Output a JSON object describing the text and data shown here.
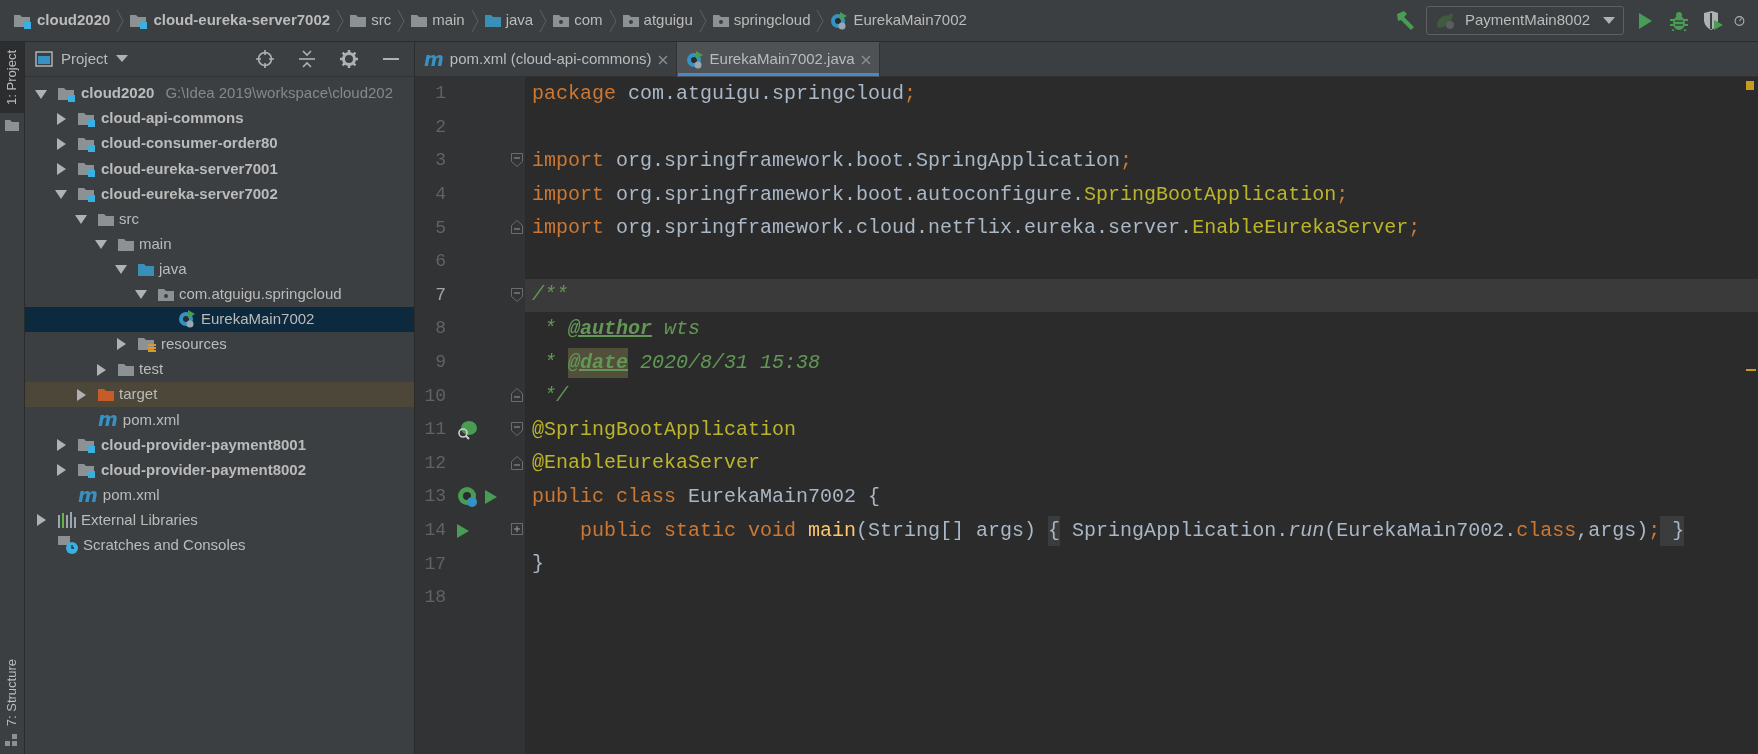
{
  "breadcrumbs": [
    {
      "label": "cloud2020",
      "kind": "module"
    },
    {
      "label": "cloud-eureka-server7002",
      "kind": "module"
    },
    {
      "label": "src",
      "kind": "folder"
    },
    {
      "label": "main",
      "kind": "folder"
    },
    {
      "label": "java",
      "kind": "source-folder"
    },
    {
      "label": "com",
      "kind": "package"
    },
    {
      "label": "atguigu",
      "kind": "package"
    },
    {
      "label": "springcloud",
      "kind": "package"
    },
    {
      "label": "EurekaMain7002",
      "kind": "class"
    }
  ],
  "run_configuration": {
    "label": "PaymentMain8002"
  },
  "tool_stripe": {
    "top": [
      {
        "label": "1: Project",
        "selected": true
      }
    ],
    "bottom": [
      {
        "label": "7: Structure",
        "selected": false
      }
    ]
  },
  "project_panel": {
    "title": "Project",
    "tree": [
      {
        "label": "cloud2020",
        "kind": "module",
        "path": "G:\\Idea 2019\\workspace\\cloud202",
        "expanded": true,
        "selected": false,
        "children": [
          {
            "label": "cloud-api-commons",
            "kind": "module",
            "expanded": false,
            "selected": false
          },
          {
            "label": "cloud-consumer-order80",
            "kind": "module",
            "expanded": false,
            "selected": false
          },
          {
            "label": "cloud-eureka-server7001",
            "kind": "module",
            "expanded": false,
            "selected": false
          },
          {
            "label": "cloud-eureka-server7002",
            "kind": "module",
            "expanded": true,
            "selected": false,
            "children": [
              {
                "label": "src",
                "kind": "folder",
                "expanded": true,
                "selected": false,
                "children": [
                  {
                    "label": "main",
                    "kind": "folder",
                    "expanded": true,
                    "selected": false,
                    "children": [
                      {
                        "label": "java",
                        "kind": "source-folder",
                        "expanded": true,
                        "selected": false,
                        "children": [
                          {
                            "label": "com.atguigu.springcloud",
                            "kind": "package",
                            "expanded": true,
                            "selected": false,
                            "children": [
                              {
                                "label": "EurekaMain7002",
                                "kind": "class",
                                "selected": true
                              }
                            ]
                          }
                        ]
                      },
                      {
                        "label": "resources",
                        "kind": "resources",
                        "expanded": false,
                        "selected": false
                      }
                    ]
                  },
                  {
                    "label": "test",
                    "kind": "folder",
                    "expanded": false,
                    "selected": false
                  }
                ]
              },
              {
                "label": "target",
                "kind": "excluded",
                "expanded": false,
                "selected": false
              },
              {
                "label": "pom.xml",
                "kind": "maven",
                "icon_text": "m",
                "selected": false
              }
            ]
          },
          {
            "label": "cloud-provider-payment8001",
            "kind": "module",
            "expanded": false,
            "selected": false
          },
          {
            "label": "cloud-provider-payment8002",
            "kind": "module",
            "expanded": false,
            "selected": false
          },
          {
            "label": "pom.xml",
            "kind": "maven",
            "icon_text": "m",
            "selected": false
          }
        ]
      },
      {
        "label": "External Libraries",
        "kind": "libraries",
        "expanded": false,
        "selected": false
      },
      {
        "label": "Scratches and Consoles",
        "kind": "scratches",
        "selected": false
      }
    ]
  },
  "tabs": [
    {
      "label": "pom.xml (cloud-api-commons)",
      "kind": "maven",
      "icon_text": "m",
      "selected": false
    },
    {
      "label": "EurekaMain7002.java",
      "kind": "class",
      "selected": true
    }
  ],
  "editor": {
    "lines": [
      {
        "number": "1",
        "current": false,
        "tokens": [
          {
            "text": "package",
            "kind": "keyword"
          },
          {
            "text": " com.atguigu.springcloud",
            "kind": "plain"
          },
          {
            "text": ";",
            "kind": "keyword"
          }
        ]
      },
      {
        "number": "2",
        "current": false
      },
      {
        "number": "3",
        "current": false,
        "gutter": [
          {
            "kind": "fold-start"
          }
        ],
        "tokens": [
          {
            "text": "import",
            "kind": "keyword"
          },
          {
            "text": " org.springframework.boot.SpringApplication",
            "kind": "plain"
          },
          {
            "text": ";",
            "kind": "keyword"
          }
        ]
      },
      {
        "number": "4",
        "current": false,
        "tokens": [
          {
            "text": "import",
            "kind": "keyword"
          },
          {
            "text": " org.springframework.boot.autoconfigure.",
            "kind": "plain"
          },
          {
            "text": "SpringBootApplication",
            "kind": "annotation"
          },
          {
            "text": ";",
            "kind": "keyword"
          }
        ]
      },
      {
        "number": "5",
        "current": false,
        "gutter": [
          {
            "kind": "fold-end"
          }
        ],
        "tokens": [
          {
            "text": "import",
            "kind": "keyword"
          },
          {
            "text": " org.springframework.cloud.netflix.eureka.server.",
            "kind": "plain"
          },
          {
            "text": "EnableEurekaServer",
            "kind": "annotation"
          },
          {
            "text": ";",
            "kind": "keyword"
          }
        ]
      },
      {
        "number": "6",
        "current": false
      },
      {
        "number": "7",
        "current": true,
        "gutter": [
          {
            "kind": "fold-start"
          }
        ],
        "tokens": [
          {
            "text": "/**",
            "kind": "comment"
          }
        ]
      },
      {
        "number": "8",
        "current": false,
        "tokens": [
          {
            "text": " * ",
            "kind": "comment"
          },
          {
            "text": "@author",
            "kind": "doc-tag"
          },
          {
            "text": " wts",
            "kind": "comment"
          }
        ]
      },
      {
        "number": "9",
        "current": false,
        "tokens": [
          {
            "text": " * ",
            "kind": "comment"
          },
          {
            "text": "@date",
            "kind": "doc-tag-match"
          },
          {
            "text": " 2020/8/31 15:38",
            "kind": "comment"
          }
        ]
      },
      {
        "number": "10",
        "current": false,
        "gutter": [
          {
            "kind": "fold-end"
          }
        ],
        "tokens": [
          {
            "text": " */",
            "kind": "comment"
          }
        ]
      },
      {
        "number": "11",
        "current": false,
        "gutter": [
          {
            "kind": "bean"
          },
          {
            "kind": "fold-start"
          }
        ],
        "tokens": [
          {
            "text": "@SpringBootApplication",
            "kind": "annotation"
          }
        ]
      },
      {
        "number": "12",
        "current": false,
        "gutter": [
          {
            "kind": "fold-end"
          }
        ],
        "tokens": [
          {
            "text": "@EnableEurekaServer",
            "kind": "annotation"
          }
        ]
      },
      {
        "number": "13",
        "current": false,
        "gutter": [
          {
            "kind": "spring-class"
          },
          {
            "kind": "run"
          }
        ],
        "tokens": [
          {
            "text": "public class",
            "kind": "keyword"
          },
          {
            "text": " EurekaMain7002 {",
            "kind": "plain"
          }
        ]
      },
      {
        "number": "14",
        "current": false,
        "gutter": [
          {
            "kind": "run"
          },
          {
            "kind": "fold-collapsed"
          }
        ],
        "tokens": [
          {
            "text": "    public static void ",
            "kind": "keyword"
          },
          {
            "text": "main",
            "kind": "method"
          },
          {
            "text": "(String[] args) ",
            "kind": "plain"
          },
          {
            "text": "{",
            "kind": "folded"
          },
          {
            "text": " SpringApplication.",
            "kind": "plain"
          },
          {
            "text": "run",
            "kind": "static-call"
          },
          {
            "text": "(EurekaMain7002.",
            "kind": "plain"
          },
          {
            "text": "class",
            "kind": "keyword"
          },
          {
            "text": ",args)",
            "kind": "plain"
          },
          {
            "text": ";",
            "kind": "keyword"
          },
          {
            "text": " }",
            "kind": "folded"
          }
        ]
      },
      {
        "number": "17",
        "current": false,
        "tokens": [
          {
            "text": "}",
            "kind": "plain"
          }
        ]
      },
      {
        "number": "18",
        "current": false
      }
    ]
  }
}
